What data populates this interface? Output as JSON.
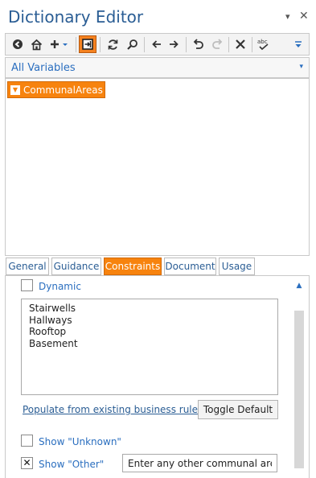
{
  "panel": {
    "title": "Dictionary Editor",
    "controls": {
      "menu_glyph": "▾",
      "close_glyph": "✕"
    }
  },
  "toolbar": {
    "items": [
      {
        "icon": "back-circle-icon",
        "glyph": "◄"
      },
      {
        "icon": "home-icon",
        "glyph": "⌂"
      },
      {
        "icon": "add-icon",
        "glyph": "+▾"
      },
      {
        "icon": "insert-variable-icon",
        "state": "active"
      },
      {
        "icon": "refresh-icon",
        "glyph": "↻"
      },
      {
        "icon": "search-icon",
        "glyph": "⌕"
      },
      {
        "icon": "arrow-left-icon",
        "glyph": "←"
      },
      {
        "icon": "arrow-right-icon",
        "glyph": "→"
      },
      {
        "icon": "undo-icon",
        "glyph": "↶"
      },
      {
        "icon": "redo-icon",
        "glyph": "↷",
        "state": "disabled"
      },
      {
        "icon": "delete-icon",
        "glyph": "✕"
      },
      {
        "icon": "spellcheck-icon",
        "glyph": "abc"
      },
      {
        "icon": "overflow-icon",
        "glyph": "▾"
      }
    ]
  },
  "variable_filter": {
    "selected": "All Variables",
    "arrow": "▾"
  },
  "tree": {
    "selected_node": "CommunalAreas",
    "node_icon_glyph": "▼"
  },
  "tabs": [
    {
      "label": "General"
    },
    {
      "label": "Guidance"
    },
    {
      "label": "Constraints",
      "active": true
    },
    {
      "label": "Document"
    },
    {
      "label": "Usage"
    }
  ],
  "constraints": {
    "dynamic": {
      "label": "Dynamic",
      "checked": false
    },
    "values": [
      "Stairwells",
      "Hallways",
      "Rooftop",
      "Basement"
    ],
    "populate_link": "Populate from existing business rules",
    "toggle_default_label": "Toggle Default",
    "show_unknown": {
      "label": "Show \"Unknown\"",
      "checked": false
    },
    "show_other": {
      "label": "Show \"Other\"",
      "checked": true,
      "mark": "✕"
    },
    "other_prompt_value": "Enter any other communal areas"
  },
  "scroll": {
    "up_glyph": "▲"
  }
}
